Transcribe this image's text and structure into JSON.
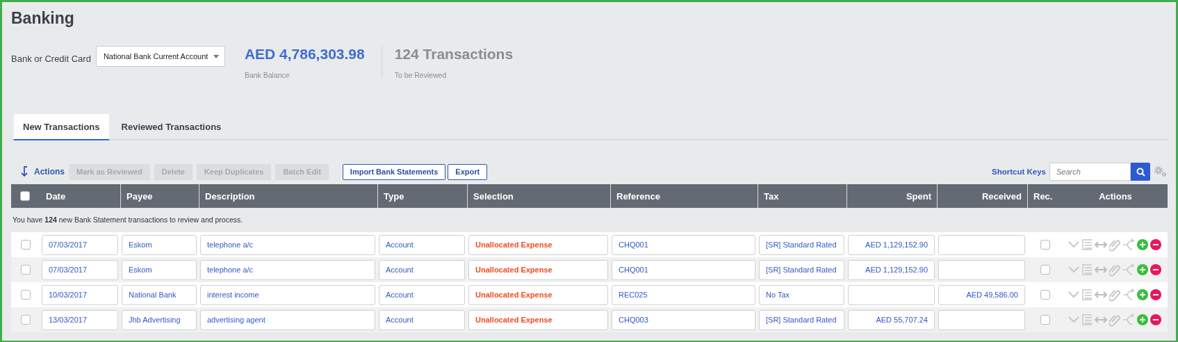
{
  "page_title": "Banking",
  "account_selector": {
    "label": "Bank or Credit Card",
    "value": "National Bank Current Account"
  },
  "balance": {
    "amount": "AED 4,786,303.98",
    "caption": "Bank Balance"
  },
  "pending": {
    "count": "124 Transactions",
    "caption": "To be Reviewed"
  },
  "tabs": [
    {
      "label": "New Transactions",
      "selected": true
    },
    {
      "label": "Reviewed Transactions",
      "selected": false
    }
  ],
  "toolbar": {
    "actions_label": "Actions",
    "bulk_buttons": [
      {
        "label": "Mark as Reviewed",
        "disabled": true
      },
      {
        "label": "Delete",
        "disabled": true
      },
      {
        "label": "Keep Duplicates",
        "disabled": true
      },
      {
        "label": "Batch Edit",
        "disabled": true
      }
    ],
    "buttons": [
      {
        "label": "Import Bank Statements"
      },
      {
        "label": "Export"
      }
    ],
    "shortcut_keys": "Shortcut Keys",
    "search": {
      "placeholder": "Search"
    }
  },
  "table": {
    "select_all_checked": false,
    "columns": [
      "Date",
      "Payee",
      "Description",
      "Type",
      "Selection",
      "Reference",
      "Tax",
      "Spent",
      "Received",
      "Rec.",
      "Actions"
    ],
    "info": "You have **124** new Bank Statement transactions to review and process.",
    "rows": [
      {
        "date": "07/03/2017",
        "payee": "Eskom",
        "description": "telephone a/c",
        "type": "Account",
        "selection": "Unallocated Expense",
        "reference": "CHQ001",
        "tax": "[SR] Standard Rated",
        "spent": "AED 1,129,152.90",
        "checked": false,
        "reconciled": false
      },
      {
        "date": "07/03/2017",
        "payee": "Eskom",
        "description": "telephone a/c",
        "type": "Account",
        "selection": "Unallocated Expense",
        "reference": "CHQ001",
        "tax": "[SR] Standard Rated",
        "spent": "AED 1,129,152.90",
        "checked": false,
        "reconciled": false
      },
      {
        "date": "10/03/2017",
        "payee": "National Bank",
        "description": "interest income",
        "type": "Account",
        "selection": "Unallocated Expense",
        "reference": "REC025",
        "tax": "No Tax",
        "received": "AED 49,586.00",
        "checked": false,
        "reconciled": false
      },
      {
        "date": "13/03/2017",
        "payee": "Jhb Advertising",
        "description": "advertising agent",
        "type": "Account",
        "selection": "Unallocated Expense",
        "reference": "CHQ003",
        "tax": "[SR] Standard Rated",
        "spent": "AED 55,707.24",
        "checked": false,
        "reconciled": false
      }
    ]
  }
}
